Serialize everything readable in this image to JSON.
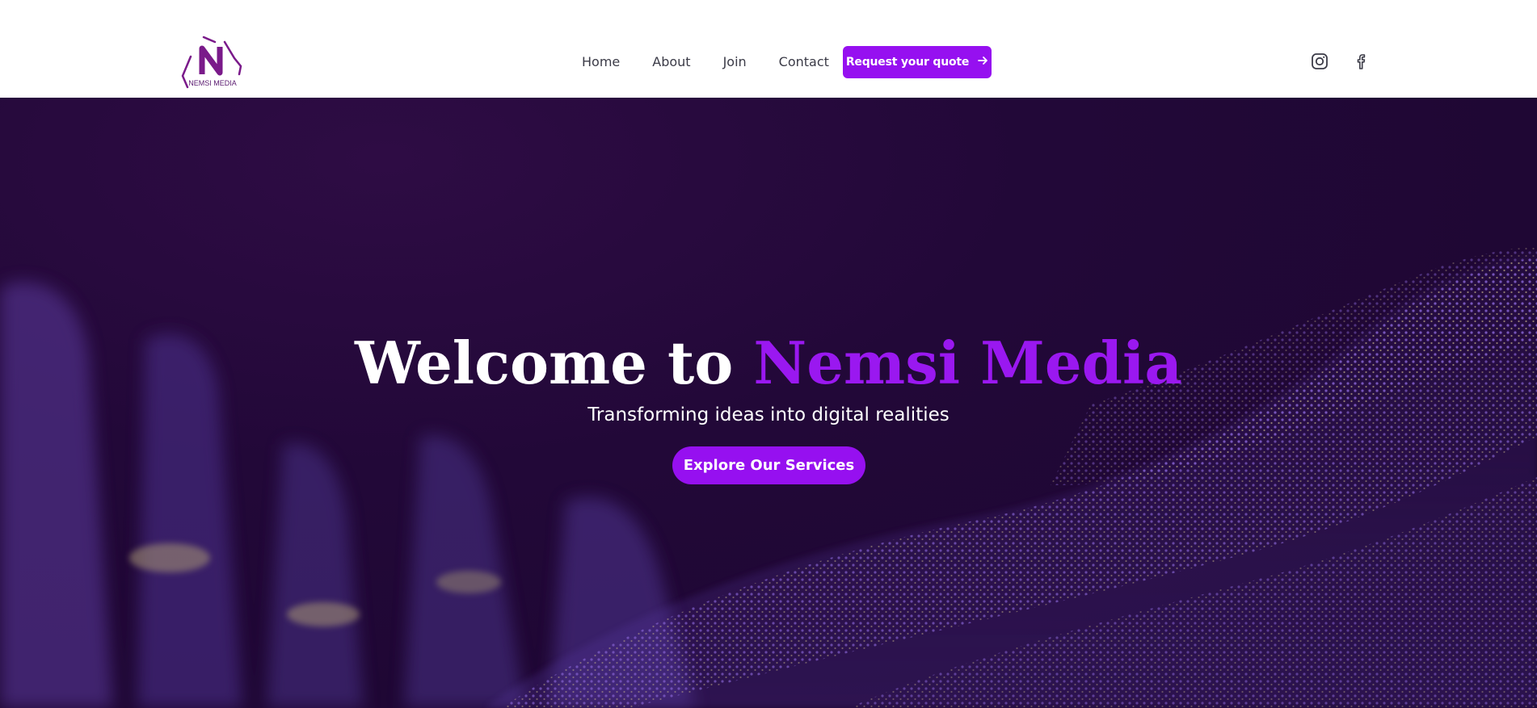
{
  "brand": {
    "name": "Nemsi Media",
    "logo_text": "NEMSI MEDIA",
    "accent_color": "#9610f0"
  },
  "nav": {
    "links": [
      {
        "label": "Home"
      },
      {
        "label": "About"
      },
      {
        "label": "Join"
      },
      {
        "label": "Contact"
      }
    ],
    "cta_label": "Request your quote",
    "cta_icon": "arrow-right-icon",
    "social": [
      {
        "icon": "instagram-icon"
      },
      {
        "icon": "facebook-icon"
      }
    ]
  },
  "hero": {
    "title_prefix": "Welcome to ",
    "title_accent": "Nemsi Media",
    "subtitle": "Transforming ideas into digital realities",
    "button_label": "Explore Our Services"
  }
}
